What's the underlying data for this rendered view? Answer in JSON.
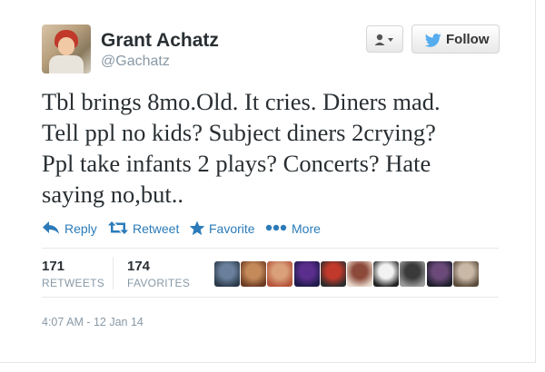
{
  "user": {
    "name": "Grant Achatz",
    "handle": "@Gachatz"
  },
  "buttons": {
    "follow_label": "Follow"
  },
  "tweet": {
    "lines": [
      "Tbl brings 8mo.Old. It cries. Diners mad.",
      "Tell ppl no kids? Subject diners 2crying?",
      "Ppl take infants 2 plays? Concerts? Hate",
      "saying no,but.."
    ]
  },
  "actions": {
    "reply": "Reply",
    "retweet": "Retweet",
    "favorite": "Favorite",
    "more": "More"
  },
  "stats": {
    "retweets": {
      "count": "171",
      "label": "RETWEETS"
    },
    "favorites": {
      "count": "174",
      "label": "FAVORITES"
    }
  },
  "facepile": [
    {
      "name": "favoriter-avatar-1",
      "colors": [
        "#6a7f9b",
        "#2b3a4a"
      ]
    },
    {
      "name": "favoriter-avatar-2",
      "colors": [
        "#c58a5a",
        "#6b3a22"
      ]
    },
    {
      "name": "favoriter-avatar-3",
      "colors": [
        "#d9a07a",
        "#b5533a"
      ]
    },
    {
      "name": "favoriter-avatar-4",
      "colors": [
        "#5a2e8c",
        "#1e1a4a"
      ]
    },
    {
      "name": "favoriter-avatar-5",
      "colors": [
        "#c0392b",
        "#2c2c2c"
      ]
    },
    {
      "name": "favoriter-avatar-6",
      "colors": [
        "#8c4a3a",
        "#e5d6c9"
      ]
    },
    {
      "name": "favoriter-avatar-7",
      "colors": [
        "#f2f2f2",
        "#222222"
      ]
    },
    {
      "name": "favoriter-avatar-8",
      "colors": [
        "#3a3a3a",
        "#9a9a9a"
      ]
    },
    {
      "name": "favoriter-avatar-9",
      "colors": [
        "#6b4a7a",
        "#1d1d2a"
      ]
    },
    {
      "name": "favoriter-avatar-10",
      "colors": [
        "#c9b8a6",
        "#5a4a3a"
      ]
    }
  ],
  "timestamp": "4:07 AM - 12 Jan 14",
  "colors": {
    "link_blue": "#2b7bb9",
    "twitter_bird": "#55acee",
    "muted_text": "#8899a6",
    "body_text": "#292f33"
  }
}
